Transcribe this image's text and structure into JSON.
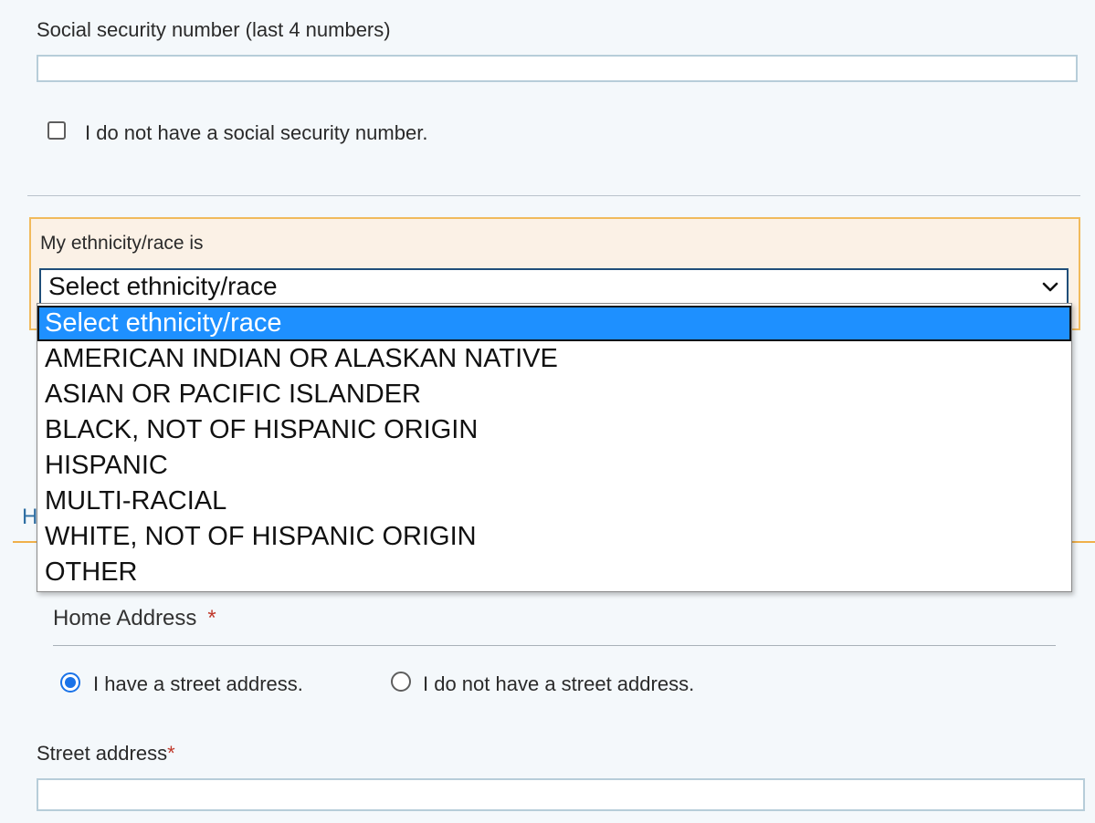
{
  "ssn": {
    "label": "Social security number (last 4 numbers)",
    "value": "",
    "no_ssn_checkbox_label": "I do not have a social security number.",
    "no_ssn_checked": false
  },
  "ethnicity": {
    "label": "My ethnicity/race is",
    "selected_value": "Select ethnicity/race",
    "options": [
      "Select ethnicity/race",
      "AMERICAN INDIAN OR ALASKAN NATIVE",
      "ASIAN OR PACIFIC ISLANDER",
      "BLACK, NOT OF HISPANIC ORIGIN",
      "HISPANIC",
      "MULTI-RACIAL",
      "WHITE, NOT OF HISPANIC ORIGIN",
      "OTHER"
    ],
    "highlighted_index": 0
  },
  "partial_heading": "H",
  "home_address": {
    "label": "Home Address",
    "required_marker": "*",
    "radio_street": "I have a street address.",
    "radio_no_street": "I do not have a street address.",
    "selected": "street"
  },
  "street_address": {
    "label": "Street address",
    "required_marker": "*",
    "value": ""
  },
  "colors": {
    "accent_orange": "#f1ba5c",
    "highlight_blue": "#1e90ff",
    "radio_blue": "#1a73e8",
    "required_red": "#c0392b"
  }
}
